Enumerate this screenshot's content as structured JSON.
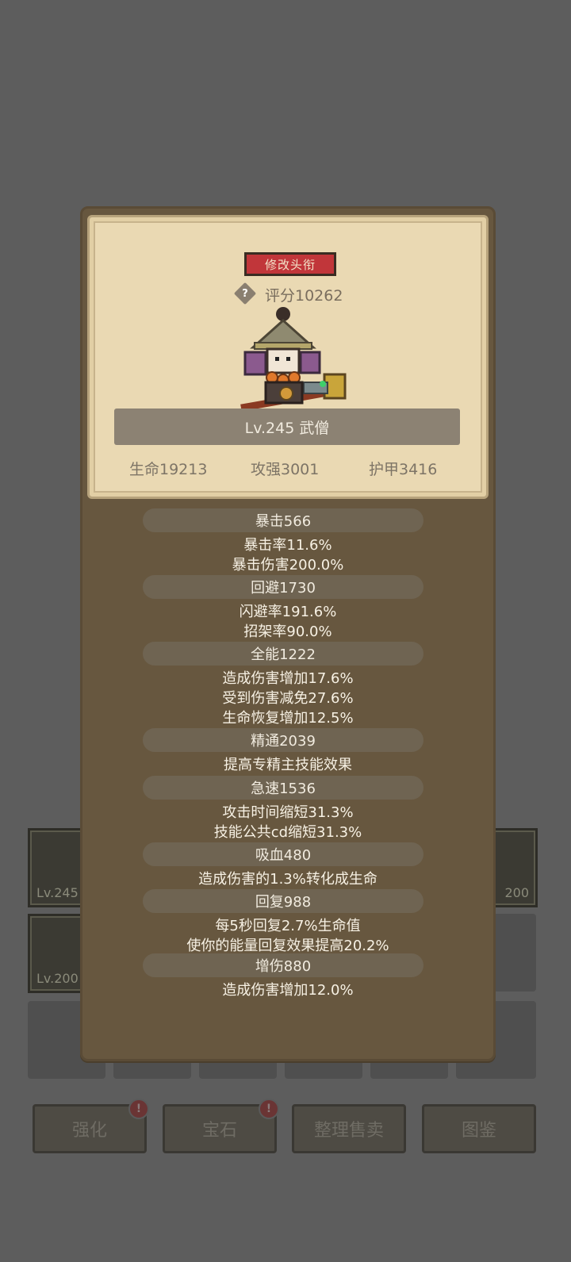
{
  "background": {
    "equipment": [
      {
        "level": "Lv.245"
      },
      {
        "level": "200"
      },
      {
        "level": "Lv.200"
      }
    ],
    "buttons": [
      {
        "label": "强化",
        "badge": "!"
      },
      {
        "label": "宝石",
        "badge": "!"
      },
      {
        "label": "整理售卖"
      },
      {
        "label": "图鉴"
      }
    ]
  },
  "profile": {
    "title_button": "修改头衔",
    "help_icon": "?",
    "score": "评分10262",
    "name": "Lv.245 武僧",
    "stats": {
      "hp": "生命19213",
      "attack": "攻强3001",
      "armor": "护甲3416"
    }
  },
  "attributes": [
    {
      "header": "暴击566",
      "lines": [
        "暴击率11.6%",
        "暴击伤害200.0%"
      ]
    },
    {
      "header": "回避1730",
      "lines": [
        "闪避率191.6%",
        "招架率90.0%"
      ]
    },
    {
      "header": "全能1222",
      "lines": [
        "造成伤害增加17.6%",
        "受到伤害减免27.6%",
        "生命恢复增加12.5%"
      ]
    },
    {
      "header": "精通2039",
      "lines": [
        "提高专精主技能效果"
      ]
    },
    {
      "header": "急速1536",
      "lines": [
        "攻击时间缩短31.3%",
        "技能公共cd缩短31.3%"
      ]
    },
    {
      "header": "吸血480",
      "lines": [
        "造成伤害的1.3%转化成生命"
      ]
    },
    {
      "header": "回复988",
      "lines": [
        "每5秒回复2.7%生命值",
        "使你的能量回复效果提高20.2%"
      ]
    },
    {
      "header": "增伤880",
      "lines": [
        "造成伤害增加12.0%"
      ]
    }
  ],
  "colors": {
    "overlay": "#5d5d5d",
    "modal": "#67573f",
    "parchment": "#ead9b3",
    "title_button": "#c1363a",
    "text_light": "#f7f1e4"
  }
}
